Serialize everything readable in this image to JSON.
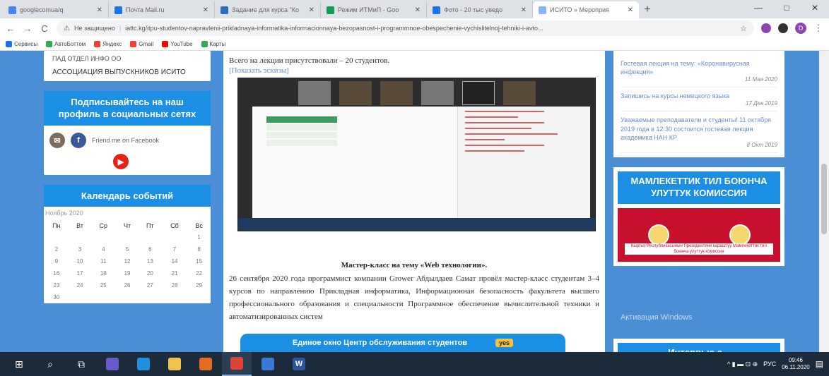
{
  "browser": {
    "tabs": [
      {
        "title": "googlecomua/q",
        "color": "#4285f4",
        "active": false
      },
      {
        "title": "Почта Mail.ru",
        "color": "#1a73e8",
        "active": false
      },
      {
        "title": "Задание для курса \"Ко",
        "color": "#2a6ebb",
        "active": false
      },
      {
        "title": "Режим ИТМиП - Goo",
        "color": "#0f9d58",
        "active": false
      },
      {
        "title": "Фото - 20 тыс уведо",
        "color": "#1a73e8",
        "active": false
      },
      {
        "title": "ИСИТО » Мероприя",
        "color": "#8ab4f8",
        "active": true
      }
    ],
    "new_tab": "+",
    "window_controls": [
      "—",
      "□",
      "✕"
    ],
    "nav": {
      "back": "←",
      "forward": "→",
      "reload": "C"
    },
    "address": {
      "warning": "Не защищено",
      "url": "iattc.kg/itpu-studentov-napravlenii-prikladnaya-informatika-informacionnaya-bezopasnost-i-programmnoe-obespechenie-vychislitelnoj-tehniki-i-avto..."
    },
    "profile_initial": "D",
    "bookmarks": [
      {
        "label": "Сервисы",
        "color": "#1a73e8"
      },
      {
        "label": "АвтоБоттом",
        "color": "#34a853"
      },
      {
        "label": "Яндекс",
        "color": "#ea4335"
      },
      {
        "label": "Gmail",
        "color": "#ea4335"
      },
      {
        "label": "YouTube",
        "color": "#ff0000"
      },
      {
        "label": "Карты",
        "color": "#34a853"
      }
    ]
  },
  "left": {
    "alumni_cut": "ПАД ОТДЕЛ ИНФО ОО",
    "alumni": "АССОЦИАЦИЯ ВЫПУСКНИКОВ ИСИТО",
    "social_title": "Подписывайтесь на наш профиль в социальных сетях",
    "facebook_link": "Friend me on Facebook",
    "calendar_title": "Календарь событий",
    "calendar_month": "Ноябрь 2020",
    "weekdays": [
      "Пн",
      "Вт",
      "Ср",
      "Чт",
      "Пт",
      "Сб",
      "Вс"
    ],
    "weeks": [
      [
        "",
        "",
        "",
        "",
        "",
        "",
        "1"
      ],
      [
        "2",
        "3",
        "4",
        "5",
        "6",
        "7",
        "8"
      ],
      [
        "9",
        "10",
        "11",
        "12",
        "13",
        "14",
        "15"
      ],
      [
        "16",
        "17",
        "18",
        "19",
        "20",
        "21",
        "22"
      ],
      [
        "23",
        "24",
        "25",
        "26",
        "27",
        "28",
        "29"
      ],
      [
        "30",
        "",
        "",
        "",
        "",
        "",
        ""
      ]
    ]
  },
  "center": {
    "line1": "Всего на лекции присутствовали – 20 студентов.",
    "show_link": "[Показать эскизы]",
    "heading": "Мастер-класс на тему «Web технологии».",
    "paragraph": "26 сентября 2020 года программист компании Grower Абдылдаев Самат провёл мастер-класс студентам 3–4 курсов по направлению Прикладная информатика, Информационная безопасность факультета высшего профессионального образования и специальности Программное обеспечение вычислительной техники и автоматизированных систем",
    "banner_text": "Единое окно Центр обслуживания студентов",
    "banner_badge": "yes"
  },
  "right": {
    "news": [
      {
        "title": "Гостевая лекция на тему: «Коронавирусная инфекция»",
        "date": "11 Мая 2020"
      },
      {
        "title": "Запишись на курсы немецкого языка",
        "date": "17 Дек 2019"
      },
      {
        "title": "Уважаемые преподаватели и студенты! 11 октября 2019 года в 12:30 состоится гостевая лекция академика НАН КР",
        "date": "8 Окт 2019"
      }
    ],
    "commission_title": "МАМЛЕКЕТТИК ТИЛ БОЮНЧА УЛУТТУК КОМИССИЯ",
    "commission_caption": "Кыргыз Республикасынын Президентине караштуу Мамлекеттик тил боюнча улуттук комиссия",
    "watermark": "Активация Windows",
    "interview_title": "Интервью с..."
  },
  "taskbar": {
    "apps": [
      {
        "name": "start",
        "glyph": "⊞",
        "color": "#ffffff"
      },
      {
        "name": "search",
        "glyph": "⌕",
        "color": "#ffffff"
      },
      {
        "name": "task-view",
        "glyph": "⧉",
        "color": "#ffffff"
      },
      {
        "name": "obs",
        "glyph": "",
        "color": "#6a5acd"
      },
      {
        "name": "edge",
        "glyph": "",
        "color": "#1f8fe0"
      },
      {
        "name": "explorer",
        "glyph": "",
        "color": "#f2c14e"
      },
      {
        "name": "media",
        "glyph": "",
        "color": "#e56b1f"
      },
      {
        "name": "chrome",
        "glyph": "",
        "color": "#db4437"
      },
      {
        "name": "app-blue",
        "glyph": "",
        "color": "#3c78d8"
      },
      {
        "name": "word",
        "glyph": "W",
        "color": "#2b579a"
      }
    ],
    "tray_icons": "^ ▮ ▬ ⊡ ⊕",
    "lang": "РУС",
    "time": "09:46",
    "date": "06.11.2020",
    "notifications": "▤"
  }
}
